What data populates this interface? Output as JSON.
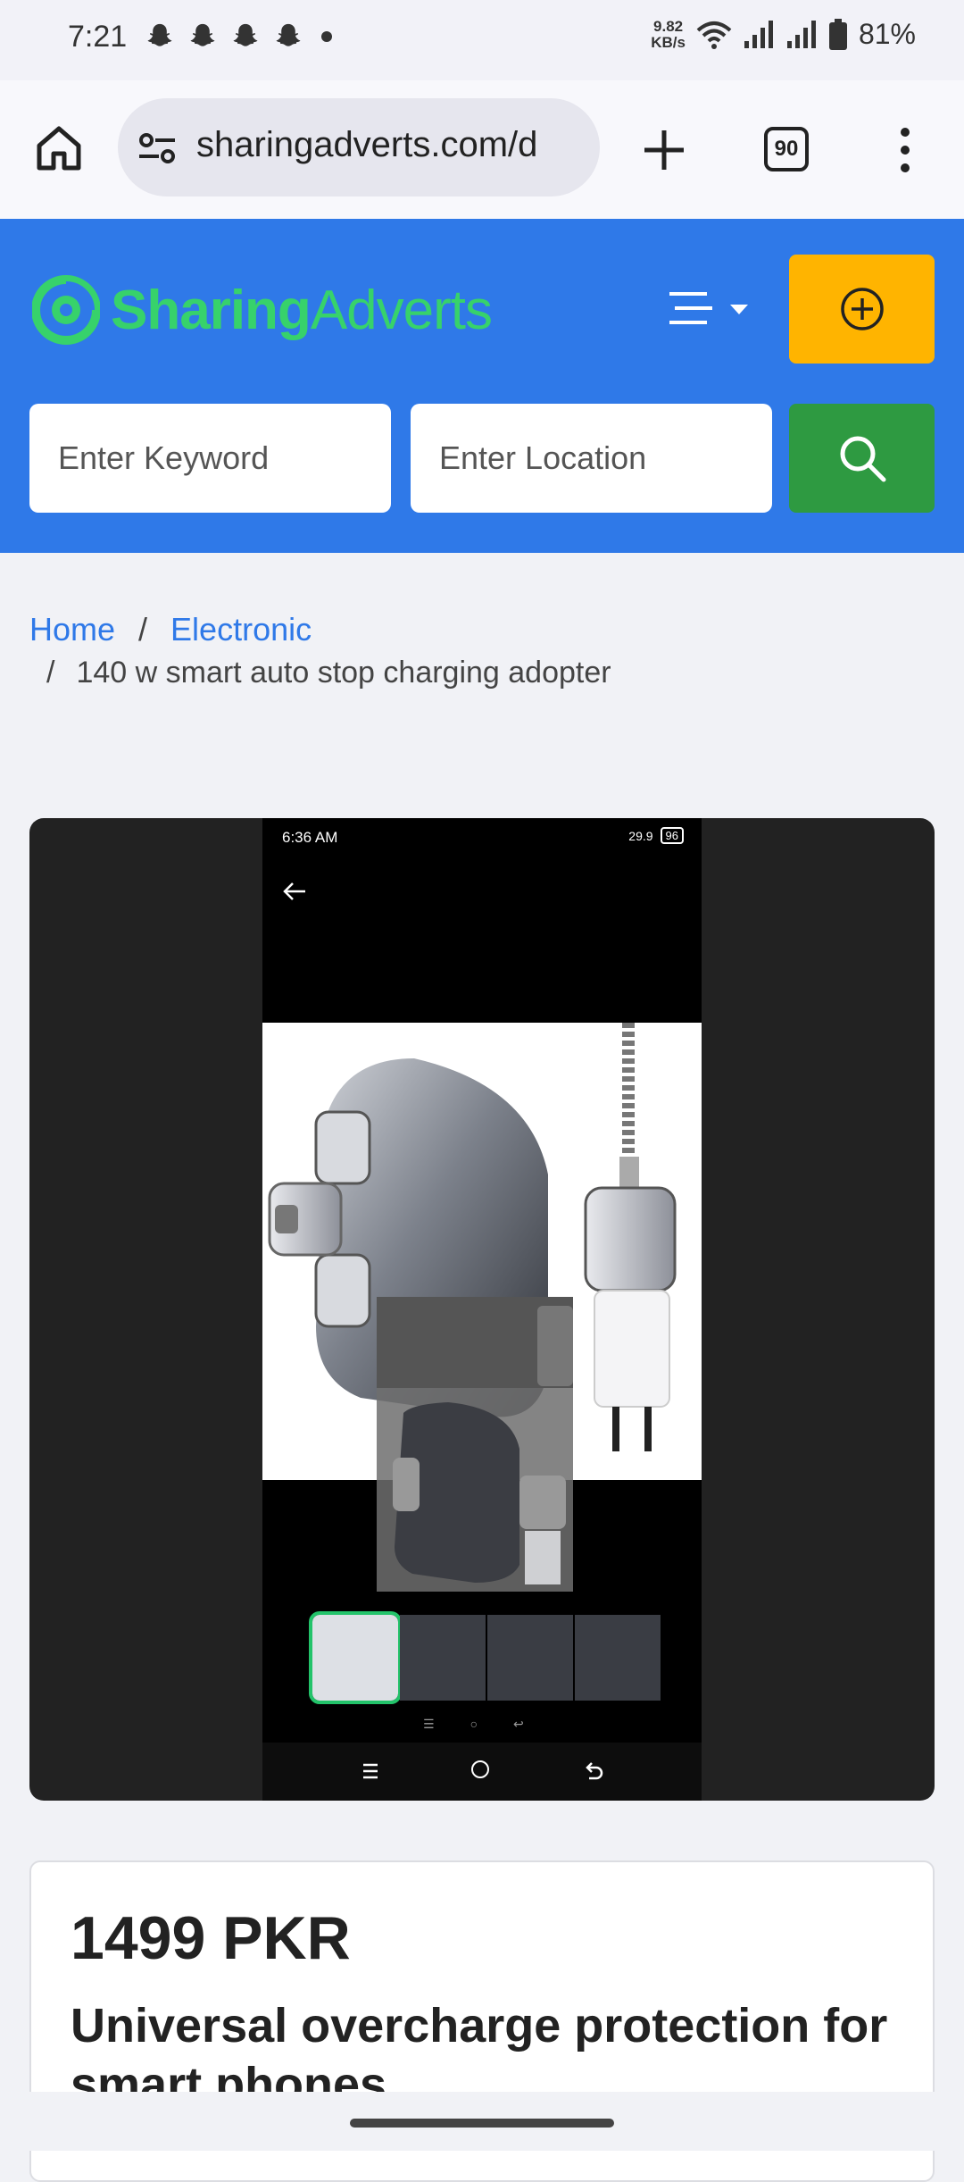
{
  "status_bar": {
    "time": "7:21",
    "net_speed_value": "9.82",
    "net_speed_unit": "KB/s",
    "battery": "81%",
    "notification_icons": [
      "snapchat-icon",
      "snapchat-icon",
      "snapchat-icon",
      "snapchat-icon"
    ]
  },
  "browser": {
    "url": "sharingadverts.com/d",
    "tab_count": "90"
  },
  "header": {
    "logo_part1": "Sharing",
    "logo_part2": "Adverts",
    "brand_color": "#2f79e8",
    "keyword_placeholder": "Enter Keyword",
    "location_placeholder": "Enter Location"
  },
  "breadcrumb": {
    "home": "Home",
    "category": "Electronic",
    "separator": "/",
    "current": "140 w smart auto stop charging adopter"
  },
  "gallery": {
    "screenshot_time": "6:36 AM",
    "screenshot_netspeed": "29.9",
    "screenshot_battery": "96",
    "thumbnail_count": 4,
    "active_thumbnail": 1
  },
  "listing": {
    "price": "1499 PKR",
    "title": "Universal overcharge protection for smart phones"
  }
}
